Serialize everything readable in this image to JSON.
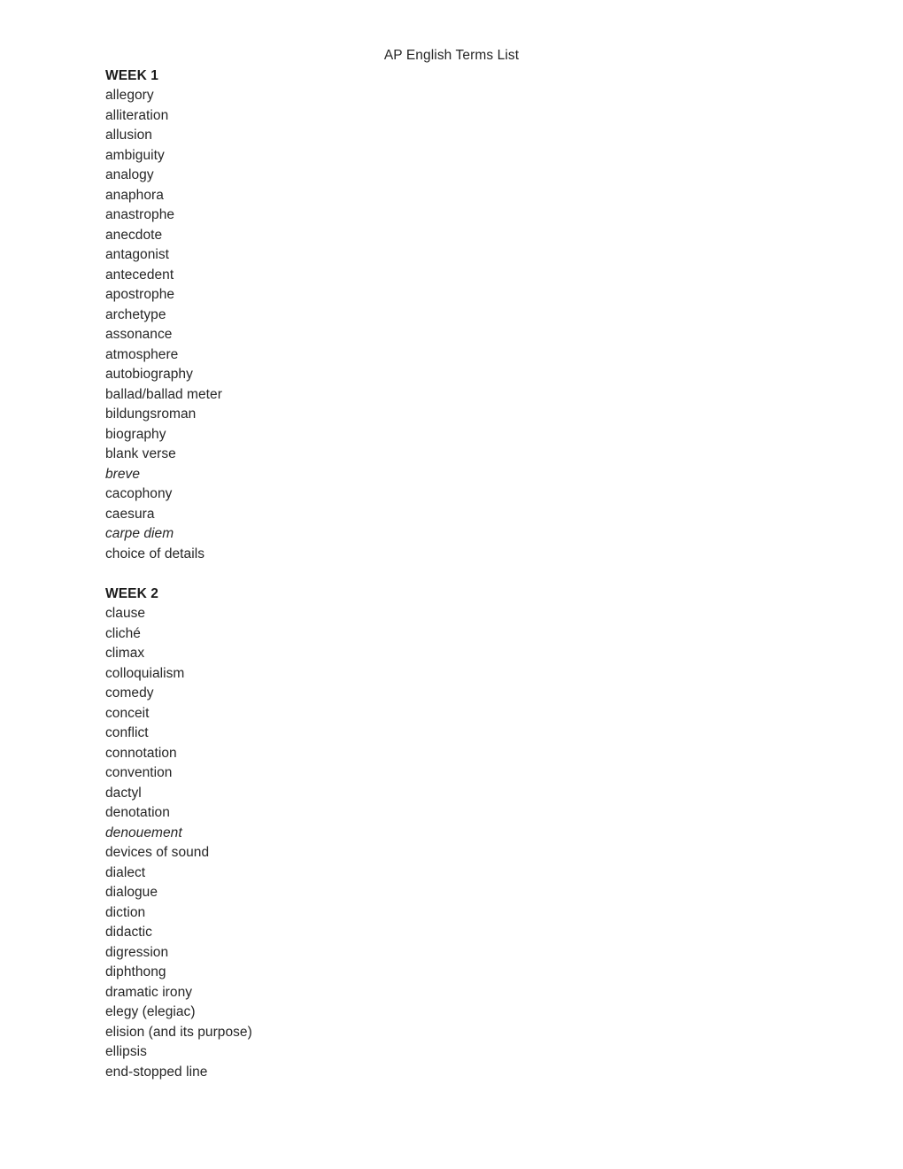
{
  "document": {
    "title": "AP English Terms List",
    "sections": [
      {
        "heading": "WEEK 1",
        "terms": [
          {
            "text": "allegory",
            "italic": false
          },
          {
            "text": "alliteration",
            "italic": false
          },
          {
            "text": "allusion",
            "italic": false
          },
          {
            "text": "ambiguity",
            "italic": false
          },
          {
            "text": "analogy",
            "italic": false
          },
          {
            "text": "anaphora",
            "italic": false
          },
          {
            "text": "anastrophe",
            "italic": false
          },
          {
            "text": "anecdote",
            "italic": false
          },
          {
            "text": "antagonist",
            "italic": false
          },
          {
            "text": "antecedent",
            "italic": false
          },
          {
            "text": "apostrophe",
            "italic": false
          },
          {
            "text": "archetype",
            "italic": false
          },
          {
            "text": "assonance",
            "italic": false
          },
          {
            "text": "atmosphere",
            "italic": false
          },
          {
            "text": "autobiography",
            "italic": false
          },
          {
            "text": "ballad/ballad meter",
            "italic": false
          },
          {
            "text": "bildungsroman",
            "italic": false
          },
          {
            "text": "biography",
            "italic": false
          },
          {
            "text": "blank verse",
            "italic": false
          },
          {
            "text": "breve",
            "italic": true
          },
          {
            "text": "cacophony",
            "italic": false
          },
          {
            "text": "caesura",
            "italic": false
          },
          {
            "text": "carpe diem",
            "italic": true
          },
          {
            "text": "choice of details",
            "italic": false
          }
        ]
      },
      {
        "heading": "WEEK 2",
        "terms": [
          {
            "text": "clause",
            "italic": false
          },
          {
            "text": "cliché",
            "italic": false
          },
          {
            "text": "climax",
            "italic": false
          },
          {
            "text": "colloquialism",
            "italic": false
          },
          {
            "text": "comedy",
            "italic": false
          },
          {
            "text": "conceit",
            "italic": false
          },
          {
            "text": "conflict",
            "italic": false
          },
          {
            "text": "connotation",
            "italic": false
          },
          {
            "text": "convention",
            "italic": false
          },
          {
            "text": "dactyl",
            "italic": false
          },
          {
            "text": "denotation",
            "italic": false
          },
          {
            "text": "denouement",
            "italic": true
          },
          {
            "text": "devices of sound",
            "italic": false
          },
          {
            "text": "dialect",
            "italic": false
          },
          {
            "text": "dialogue",
            "italic": false
          },
          {
            "text": "diction",
            "italic": false
          },
          {
            "text": "didactic",
            "italic": false
          },
          {
            "text": "digression",
            "italic": false
          },
          {
            "text": "diphthong",
            "italic": false
          },
          {
            "text": "dramatic irony",
            "italic": false
          },
          {
            "text": "elegy (elegiac)",
            "italic": false
          },
          {
            "text": "elision (and its purpose)",
            "italic": false
          },
          {
            "text": "ellipsis",
            "italic": false
          },
          {
            "text": "end-stopped line",
            "italic": false
          }
        ]
      }
    ]
  }
}
